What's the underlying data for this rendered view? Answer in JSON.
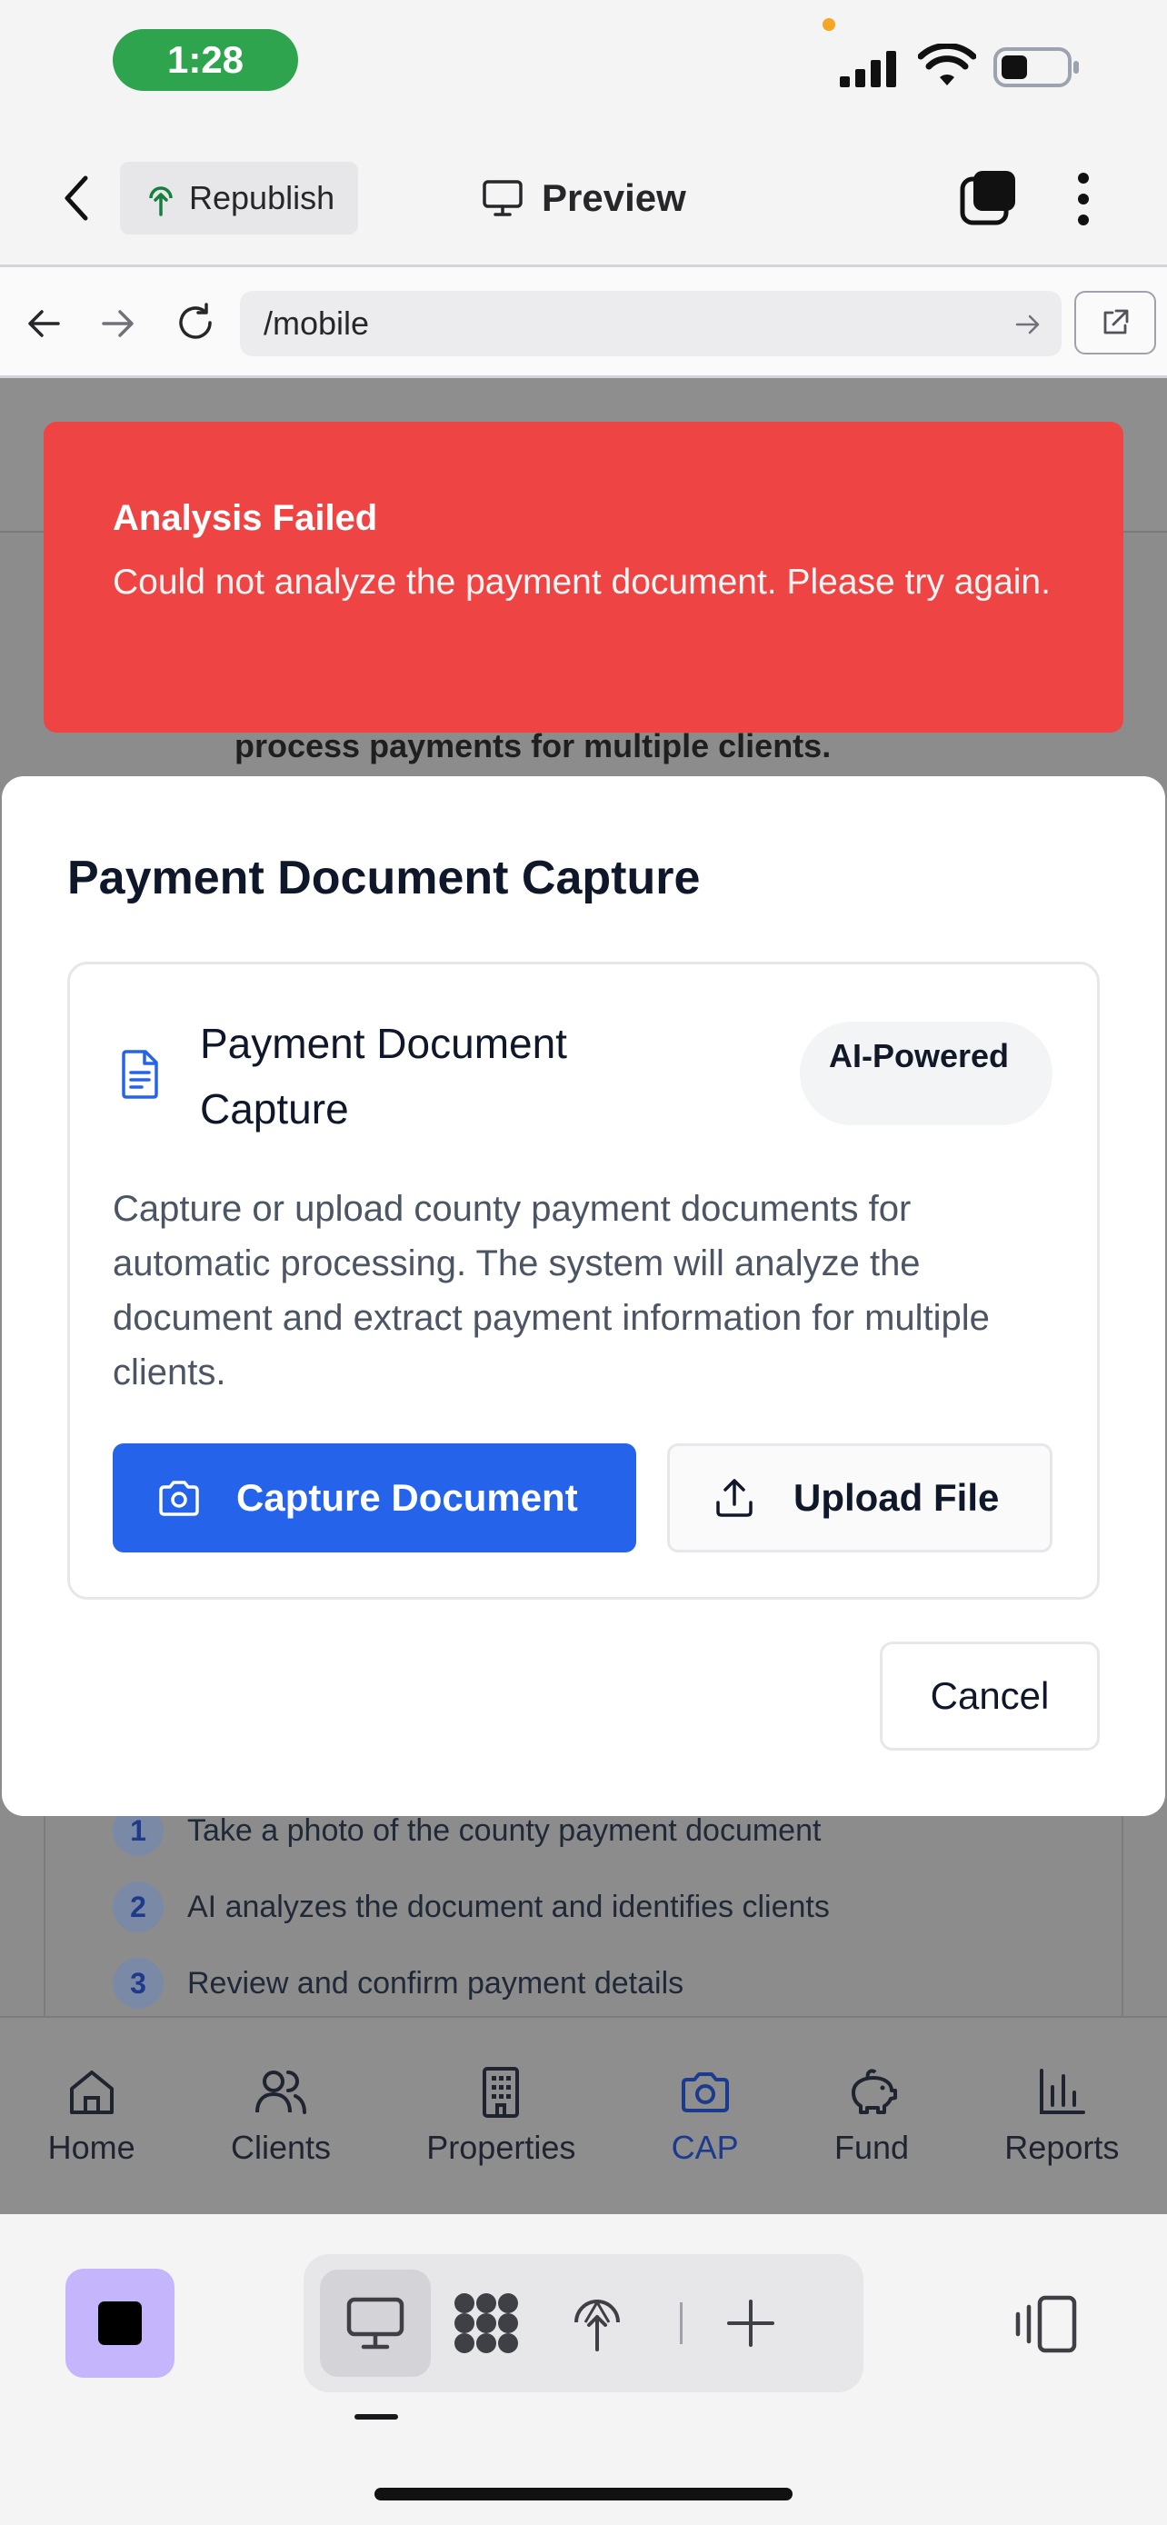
{
  "status_bar": {
    "time": "1:28"
  },
  "header": {
    "republish_label": "Republish",
    "preview_label": "Preview"
  },
  "browser": {
    "url": "/mobile"
  },
  "background_page": {
    "partial_text": "process payments for multiple clients.",
    "steps": [
      {
        "num": "1",
        "text": "Take a photo of the county payment document"
      },
      {
        "num": "2",
        "text": "AI analyzes the document and identifies clients"
      },
      {
        "num": "3",
        "text": "Review and confirm payment details"
      }
    ]
  },
  "toast": {
    "title": "Analysis Failed",
    "message": "Could not analyze the payment document. Please try again."
  },
  "modal": {
    "title": "Payment Document Capture",
    "card": {
      "title": "Payment Document Capture",
      "badge": "AI-Powered",
      "description": "Capture or upload county payment documents for automatic processing. The system will analyze the document and extract payment information for multiple clients.",
      "capture_label": "Capture Document",
      "upload_label": "Upload File"
    },
    "cancel_label": "Cancel"
  },
  "bottom_nav": {
    "items": [
      {
        "label": "Home",
        "icon": "home-icon"
      },
      {
        "label": "Clients",
        "icon": "users-icon"
      },
      {
        "label": "Properties",
        "icon": "building-icon"
      },
      {
        "label": "CAP",
        "icon": "camera-icon",
        "active": true
      },
      {
        "label": "Fund",
        "icon": "piggy-bank-icon"
      },
      {
        "label": "Reports",
        "icon": "bar-chart-icon"
      }
    ]
  },
  "colors": {
    "accent": "#2563eb",
    "toast_bg": "#ef4444",
    "time_pill": "#2ea44f",
    "stop_button": "#c4b5fd"
  }
}
